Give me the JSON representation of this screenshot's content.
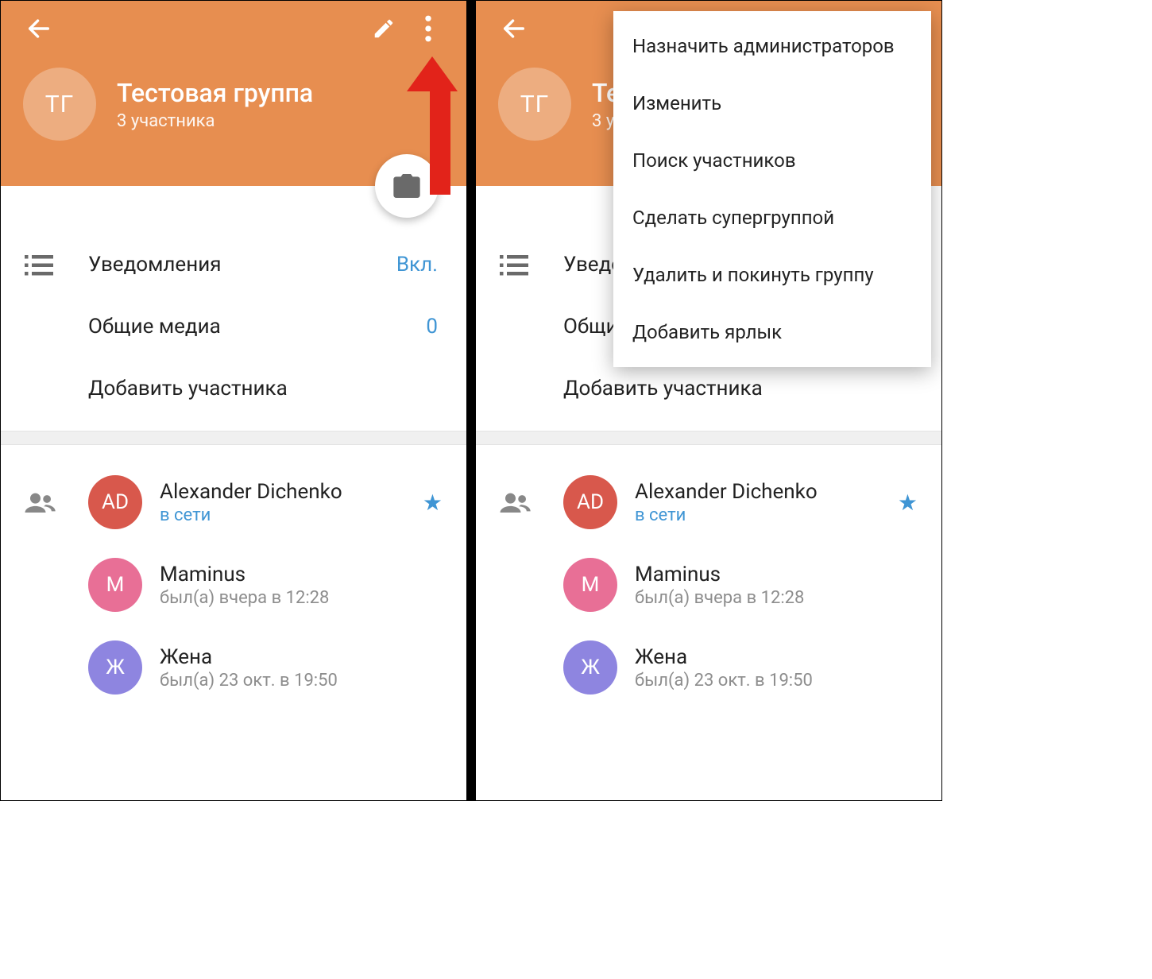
{
  "group": {
    "avatar_initials": "ТГ",
    "title": "Тестовая группа",
    "subtitle": "3 участника"
  },
  "settings": {
    "notifications": {
      "label": "Уведомления",
      "value": "Вкл."
    },
    "shared_media": {
      "label": "Общие медиа",
      "value": "0"
    },
    "add_member": {
      "label": "Добавить участника"
    }
  },
  "members": [
    {
      "initials": "AD",
      "color": "red",
      "name": "Alexander Dichenko",
      "status": "в сети",
      "online": true,
      "admin": true
    },
    {
      "initials": "M",
      "color": "pink",
      "name": "Maminus",
      "status": "был(а) вчера в 12:28",
      "online": false,
      "admin": false
    },
    {
      "initials": "Ж",
      "color": "violet",
      "name": "Жена",
      "status": "был(а) 23 окт. в 19:50",
      "online": false,
      "admin": false
    }
  ],
  "menu": {
    "items": [
      "Назначить администраторов",
      "Изменить",
      "Поиск участников",
      "Сделать супергруппой",
      "Удалить и покинуть группу",
      "Добавить ярлык"
    ]
  }
}
